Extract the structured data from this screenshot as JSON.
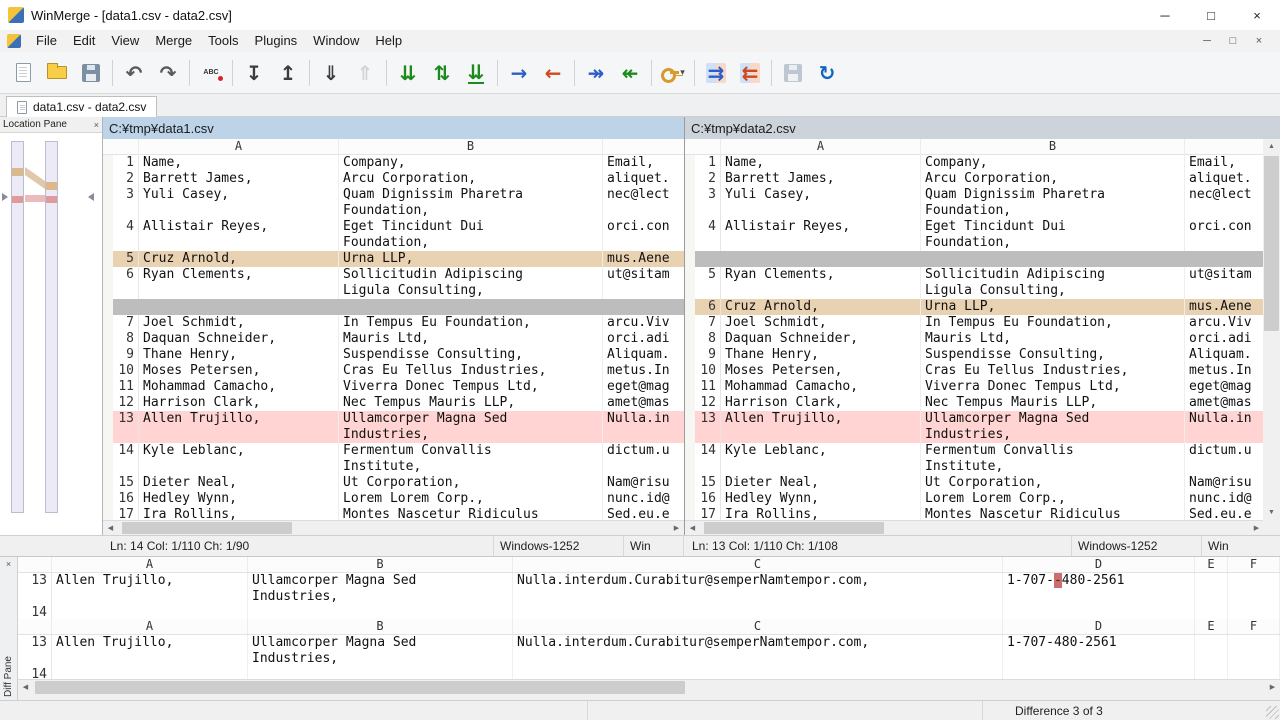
{
  "window": {
    "title": "WinMerge - [data1.csv - data2.csv]",
    "controls": {
      "minimize": "─",
      "maximize": "□",
      "close": "×"
    }
  },
  "menu": {
    "items": [
      "File",
      "Edit",
      "View",
      "Merge",
      "Tools",
      "Plugins",
      "Window",
      "Help"
    ],
    "child_controls": {
      "minimize": "─",
      "restore": "□",
      "close": "×"
    }
  },
  "toolbar": {
    "items": [
      {
        "name": "new",
        "kind": "page"
      },
      {
        "name": "open",
        "kind": "folder"
      },
      {
        "name": "save",
        "kind": "floppy"
      },
      {
        "kind": "sep"
      },
      {
        "name": "undo",
        "glyph": "↶",
        "color": "#5a5a5a"
      },
      {
        "name": "redo",
        "glyph": "↷",
        "color": "#5a5a5a"
      },
      {
        "kind": "sep"
      },
      {
        "name": "record-plugin",
        "kind": "rec",
        "label": "ABC"
      },
      {
        "kind": "sep"
      },
      {
        "name": "next-line-diff",
        "glyph": "↧",
        "color": "#3c3c3c"
      },
      {
        "name": "prev-line-diff",
        "glyph": "↥",
        "color": "#3c3c3c"
      },
      {
        "kind": "sep"
      },
      {
        "name": "next-file-diff",
        "glyph": "⇓",
        "color": "#3c3c3c"
      },
      {
        "name": "prev-file-diff",
        "glyph": "⇑",
        "color": "#a8a8a8",
        "enabled": false
      },
      {
        "kind": "sep"
      },
      {
        "name": "next-difference",
        "glyph": "⇊",
        "color": "#1d8a1d"
      },
      {
        "name": "current-difference",
        "glyph": "⇅",
        "color": "#1d8a1d"
      },
      {
        "name": "last-difference",
        "glyph": "⇊",
        "color": "#1d8a1d",
        "underline": true
      },
      {
        "kind": "sep"
      },
      {
        "name": "copy-right",
        "glyph": "→",
        "color": "#2b5fc7"
      },
      {
        "name": "copy-left",
        "glyph": "←",
        "color": "#d0491b"
      },
      {
        "kind": "sep"
      },
      {
        "name": "copy-right-and-advance",
        "glyph": "↠",
        "color": "#2b5fc7"
      },
      {
        "name": "copy-left-and-advance",
        "glyph": "↞",
        "color": "#1d8a1d"
      },
      {
        "kind": "sep"
      },
      {
        "name": "options",
        "kind": "key",
        "caret": "▾"
      },
      {
        "kind": "sep"
      },
      {
        "name": "copy-all-right",
        "glyph": "⇉",
        "color": "#2b5fc7",
        "boxed": true
      },
      {
        "name": "copy-all-left",
        "glyph": "⇇",
        "color": "#d0491b",
        "boxed": true
      },
      {
        "kind": "sep"
      },
      {
        "name": "save-all",
        "kind": "floppy",
        "enabled": false
      },
      {
        "name": "refresh",
        "glyph": "↻",
        "color": "#1565c0"
      }
    ]
  },
  "tab": {
    "label": "data1.csv - data2.csv"
  },
  "location_pane": {
    "title": "Location Pane",
    "close": "×"
  },
  "left_pane": {
    "path": "C:¥tmp¥data1.csv",
    "columns": [
      "A",
      "B"
    ],
    "rows": [
      {
        "n": "1",
        "a": "Name,",
        "b": [
          "Company,"
        ],
        "e": "Email,"
      },
      {
        "n": "2",
        "a": "Barrett James,",
        "b": [
          "Arcu Corporation,"
        ],
        "e": "aliquet."
      },
      {
        "n": "3",
        "a": "Yuli Casey,",
        "b": [
          "Quam Dignissim Pharetra",
          "Foundation,"
        ],
        "e": "nec@lect"
      },
      {
        "n": "4",
        "a": "Allistair Reyes,",
        "b": [
          "Eget Tincidunt Dui",
          "Foundation,"
        ],
        "e": "orci.con"
      },
      {
        "n": "5",
        "a": "Cruz Arnold,",
        "b": [
          "Urna LLP,"
        ],
        "e": "mus.Aene",
        "t": "moved"
      },
      {
        "n": "6",
        "a": "Ryan Clements,",
        "b": [
          "Sollicitudin Adipiscing",
          "Ligula Consulting,"
        ],
        "e": "ut@sitam"
      },
      {
        "t": "filler"
      },
      {
        "n": "7",
        "a": "Joel Schmidt,",
        "b": [
          "In Tempus Eu Foundation,"
        ],
        "e": "arcu.Viv"
      },
      {
        "n": "8",
        "a": "Daquan Schneider,",
        "b": [
          "Mauris Ltd,"
        ],
        "e": "orci.adi"
      },
      {
        "n": "9",
        "a": "Thane Henry,",
        "b": [
          "Suspendisse Consulting,"
        ],
        "e": "Aliquam."
      },
      {
        "n": "10",
        "a": "Moses Petersen,",
        "b": [
          "Cras Eu Tellus Industries,"
        ],
        "e": "metus.In"
      },
      {
        "n": "11",
        "a": "Mohammad Camacho,",
        "b": [
          "Viverra Donec Tempus Ltd,"
        ],
        "e": "eget@mag"
      },
      {
        "n": "12",
        "a": "Harrison Clark,",
        "b": [
          "Nec Tempus Mauris LLP,"
        ],
        "e": "amet@mas"
      },
      {
        "n": "13",
        "a": "Allen Trujillo,",
        "b": [
          "Ullamcorper Magna Sed",
          "Industries,"
        ],
        "e": "Nulla.in",
        "t": "diff"
      },
      {
        "n": "14",
        "a": "Kyle Leblanc,",
        "b": [
          "Fermentum Convallis",
          "Institute,"
        ],
        "e": "dictum.u"
      },
      {
        "n": "15",
        "a": "Dieter Neal,",
        "b": [
          "Ut Corporation,"
        ],
        "e": "Nam@risu"
      },
      {
        "n": "16",
        "a": "Hedley Wynn,",
        "b": [
          "Lorem Lorem Corp.,"
        ],
        "e": "nunc.id@"
      },
      {
        "n": "17",
        "a": "Ira Rollins,",
        "b": [
          "Montes Nascetur Ridiculus"
        ],
        "e": "Sed.eu.e"
      }
    ],
    "status": {
      "position": "Ln: 14  Col: 1/110  Ch: 1/90",
      "encoding": "Windows-1252",
      "eol": "Win"
    }
  },
  "right_pane": {
    "path": "C:¥tmp¥data2.csv",
    "columns": [
      "A",
      "B"
    ],
    "rows": [
      {
        "n": "1",
        "a": "Name,",
        "b": [
          "Company,"
        ],
        "e": "Email,"
      },
      {
        "n": "2",
        "a": "Barrett James,",
        "b": [
          "Arcu Corporation,"
        ],
        "e": "aliquet."
      },
      {
        "n": "3",
        "a": "Yuli Casey,",
        "b": [
          "Quam Dignissim Pharetra",
          "Foundation,"
        ],
        "e": "nec@lect"
      },
      {
        "n": "4",
        "a": "Allistair Reyes,",
        "b": [
          "Eget Tincidunt Dui",
          "Foundation,"
        ],
        "e": "orci.con"
      },
      {
        "t": "filler"
      },
      {
        "n": "5",
        "a": "Ryan Clements,",
        "b": [
          "Sollicitudin Adipiscing",
          "Ligula Consulting,"
        ],
        "e": "ut@sitam"
      },
      {
        "n": "6",
        "a": "Cruz Arnold,",
        "b": [
          "Urna LLP,"
        ],
        "e": "mus.Aene",
        "t": "moved"
      },
      {
        "n": "7",
        "a": "Joel Schmidt,",
        "b": [
          "In Tempus Eu Foundation,"
        ],
        "e": "arcu.Viv"
      },
      {
        "n": "8",
        "a": "Daquan Schneider,",
        "b": [
          "Mauris Ltd,"
        ],
        "e": "orci.adi"
      },
      {
        "n": "9",
        "a": "Thane Henry,",
        "b": [
          "Suspendisse Consulting,"
        ],
        "e": "Aliquam."
      },
      {
        "n": "10",
        "a": "Moses Petersen,",
        "b": [
          "Cras Eu Tellus Industries,"
        ],
        "e": "metus.In"
      },
      {
        "n": "11",
        "a": "Mohammad Camacho,",
        "b": [
          "Viverra Donec Tempus Ltd,"
        ],
        "e": "eget@mag"
      },
      {
        "n": "12",
        "a": "Harrison Clark,",
        "b": [
          "Nec Tempus Mauris LLP,"
        ],
        "e": "amet@mas"
      },
      {
        "n": "13",
        "a": "Allen Trujillo,",
        "b": [
          "Ullamcorper Magna Sed",
          "Industries,"
        ],
        "e": "Nulla.in",
        "t": "diff"
      },
      {
        "n": "14",
        "a": "Kyle Leblanc,",
        "b": [
          "Fermentum Convallis",
          "Institute,"
        ],
        "e": "dictum.u"
      },
      {
        "n": "15",
        "a": "Dieter Neal,",
        "b": [
          "Ut Corporation,"
        ],
        "e": "Nam@risu"
      },
      {
        "n": "16",
        "a": "Hedley Wynn,",
        "b": [
          "Lorem Lorem Corp.,"
        ],
        "e": "nunc.id@"
      },
      {
        "n": "17",
        "a": "Ira Rollins,",
        "b": [
          "Montes Nascetur Ridiculus"
        ],
        "e": "Sed.eu.e"
      }
    ],
    "status": {
      "position": "Ln: 13  Col: 1/110  Ch: 1/108",
      "encoding": "Windows-1252",
      "eol": "Win"
    }
  },
  "diff_pane": {
    "title": "Diff Pane",
    "close": "×",
    "columns": [
      "A",
      "B",
      "C",
      "D",
      "E",
      "F"
    ],
    "sections": [
      {
        "rows": [
          {
            "n": "13",
            "a": "Allen Trujillo,",
            "b": [
              "Ullamcorper Magna Sed",
              "Industries,"
            ],
            "c": "Nulla.interdum.Curabitur@semperNamtempor.com,",
            "d_pre": "1-707-",
            "d_diff": "-",
            "d_post": "480-2561"
          },
          {
            "n": "14"
          }
        ]
      },
      {
        "rows": [
          {
            "n": "13",
            "a": "Allen Trujillo,",
            "b": [
              "Ullamcorper Magna Sed",
              "Industries,"
            ],
            "c": "Nulla.interdum.Curabitur@semperNamtempor.com,",
            "d_pre": "1-707-480-2561",
            "d_diff": "",
            "d_post": ""
          },
          {
            "n": "14"
          }
        ]
      }
    ]
  },
  "status_bar": {
    "difference": "Difference 3 of 3"
  },
  "icons": {
    "scroll_left": "◀",
    "scroll_right": "▶",
    "scroll_up": "▲",
    "scroll_down": "▼"
  },
  "colors": {
    "moved_block": "#e9d2b2",
    "difference": "#ffd4d2",
    "word_difference": "#c9706f",
    "filler": "#bdbdbd",
    "active_header": "#bcd3e8",
    "inactive_header": "#ccd3da"
  }
}
